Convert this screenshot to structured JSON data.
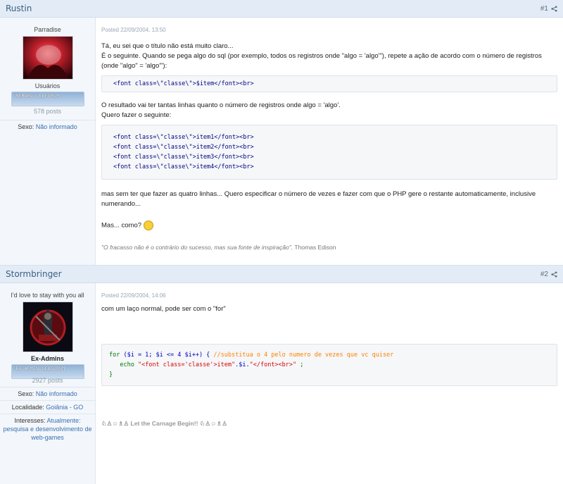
{
  "posts": [
    {
      "author": "Rustin",
      "number": "#1",
      "user_title": "Parradise",
      "rank": "Usuários",
      "badge": "MEMBRO UEBFORUM",
      "posts_count": "578 posts",
      "fields": [
        {
          "label": "Sexo:",
          "value": "Não informado"
        }
      ],
      "posted": "Posted 22/09/2004, 13:50",
      "para1_line1": "Tá, eu sei que o título não está muito claro...",
      "para1_line2": "É o seguinte. Quando se pega algo do sql (por exemplo, todos os registros onde \"algo = 'algo'\"), repete a ação de acordo com o número de registros (onde \"algo\" = 'algo'\"):",
      "code1": "<font class=\\\"classe\\\">$item</font><br>",
      "para2_line1": "O resultado vai ter tantas linhas quanto o número de registros onde algo = 'algo'.",
      "para2_line2": "Quero fazer o seguinte:",
      "code2": [
        "<font class=\\\"classe\\\">item1</font><br>",
        "<font class=\\\"classe\\\">item2</font><br>",
        "<font class=\\\"classe\\\">item3</font><br>",
        "<font class=\\\"classe\\\">item4</font><br>"
      ],
      "para3": "mas sem ter que fazer as quatro linhas... Quero especificar o número de vezes e fazer com que o PHP gere o restante automaticamente, inclusive numerando...",
      "para4": "Mas... como?",
      "sig_quote": "\"O fracasso não é o contrário do sucesso, mas sua fonte de inspiração\".",
      "sig_author": "Thomas Edison"
    },
    {
      "author": "Stormbringer",
      "number": "#2",
      "user_title": "I'd love to stay with you all",
      "rank": "Ex-Admins",
      "badge": "EX-ADMIN UEBFORUM",
      "posts_count": "2927 posts",
      "fields": [
        {
          "label": "Sexo:",
          "value": "Não informado"
        },
        {
          "label": "Localidade:",
          "value": "Goiânia - GO"
        },
        {
          "label": "Interesses:",
          "value": "Atualmente: pesquisa e desenvolvimento de web-games"
        }
      ],
      "posted": "Posted 22/09/2004, 14:06",
      "para1": "com um laço normal, pode ser com o \"for\"",
      "code_line1_a": "for",
      "code_line1_b": " ($i = 1; $i <= 4 $i++) { ",
      "code_line1_c": "//substitua o 4 pelo numero de vezes que vc quiser",
      "code_line2_a": "   echo ",
      "code_line2_b": "\"<font class='classe'>item\"",
      "code_line2_c": ".$i.",
      "code_line2_d": "\"</font><br>\"",
      "code_line2_e": " ;",
      "code_line3": "}",
      "signature": "Let the Carnage Begin!!"
    }
  ],
  "colors": {
    "accent": "#3a5f85",
    "header_bg": "#e3ecf6",
    "link": "#3a6fb0"
  }
}
